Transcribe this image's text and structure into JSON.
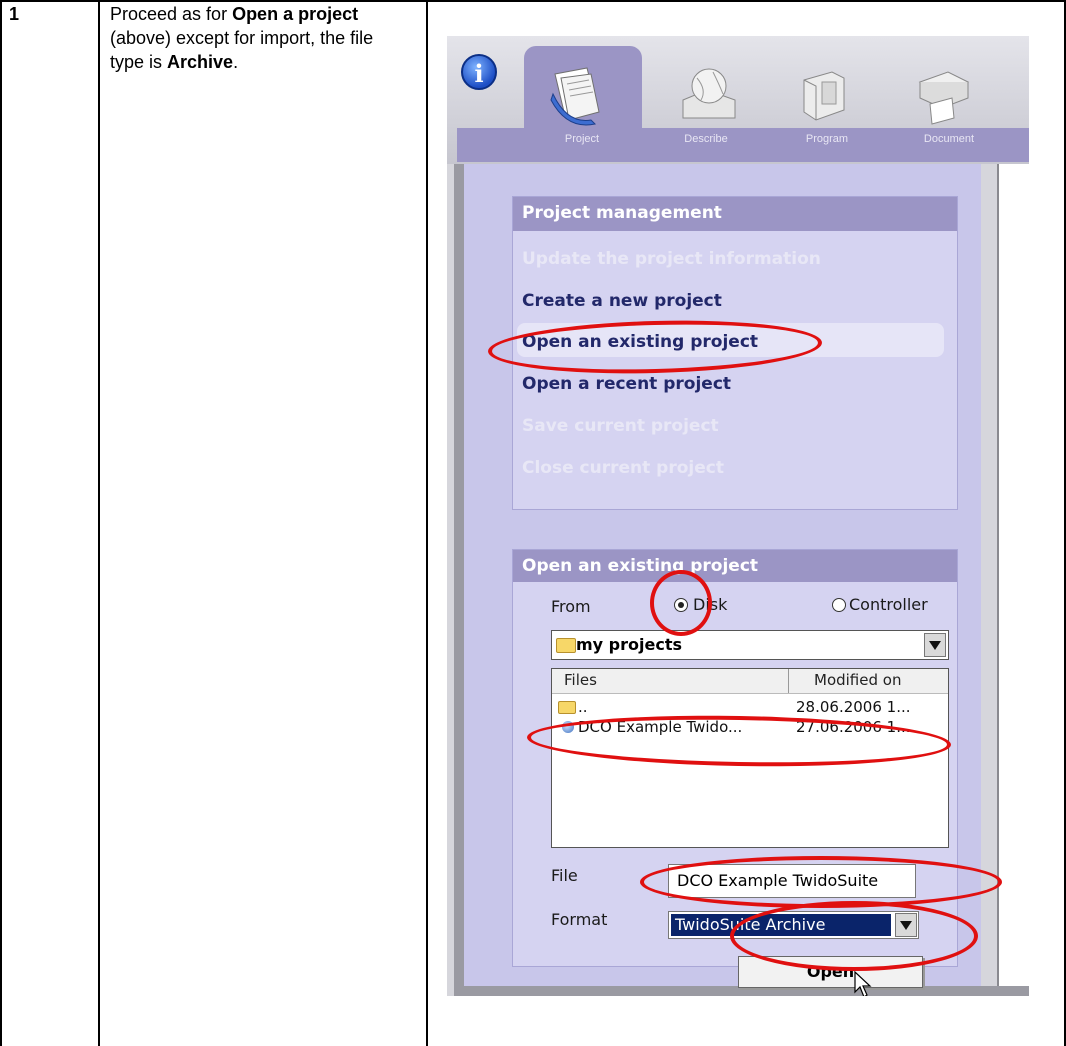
{
  "step": {
    "number": "1",
    "text_parts": [
      {
        "t": "Proceed as for ",
        "b": false
      },
      {
        "t": "Open a project",
        "b": true
      },
      {
        "t": " (above) except for import, the file type is ",
        "b": false
      },
      {
        "t": "Archive",
        "b": true
      },
      {
        "t": ".",
        "b": false
      }
    ]
  },
  "app": {
    "tabs": [
      {
        "label": "Project",
        "active": true
      },
      {
        "label": "Describe",
        "active": false
      },
      {
        "label": "Program",
        "active": false
      },
      {
        "label": "Document",
        "active": false
      }
    ],
    "project_management": {
      "title": "Project management",
      "items": [
        {
          "label": "Update the project information",
          "enabled": false
        },
        {
          "label": "Create a new project",
          "enabled": true
        },
        {
          "label": "Open an existing project",
          "enabled": true,
          "selected": true
        },
        {
          "label": "Open a recent project",
          "enabled": true
        },
        {
          "label": "Save current project",
          "enabled": false
        },
        {
          "label": "Close current project",
          "enabled": false
        }
      ]
    },
    "open_project": {
      "title": "Open an existing project",
      "from_label": "From",
      "source_options": [
        {
          "label": "Disk",
          "selected": true
        },
        {
          "label": "Controller",
          "selected": false
        }
      ],
      "folder": "my projects",
      "columns": [
        "Files",
        "Modified on"
      ],
      "files": [
        {
          "name": "..",
          "modified": "28.06.2006 1...",
          "icon": "folder-icon"
        },
        {
          "name": "DCO Example Twido...",
          "modified": "27.06.2006 1...",
          "icon": "project-file-icon"
        }
      ],
      "file_label": "File",
      "file_value": "DCO Example TwidoSuite",
      "format_label": "Format",
      "format_value": "TwidoSuite Archive",
      "open_button": "Open"
    },
    "colors": {
      "accent": "#9b95c5",
      "panel": "#c8c6ea",
      "annotation": "#e01010",
      "selection": "#0a246a"
    }
  }
}
